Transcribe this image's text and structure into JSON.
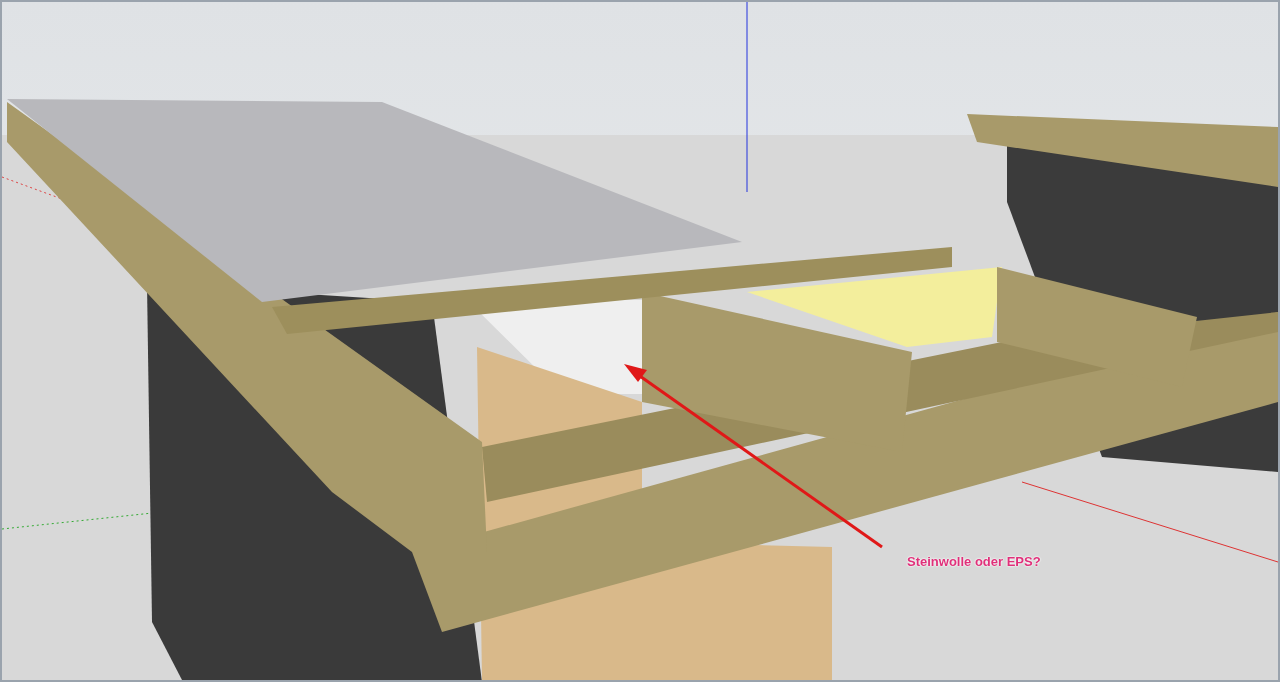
{
  "viewport": {
    "annotation": {
      "text": "Steinwolle oder EPS?"
    }
  }
}
